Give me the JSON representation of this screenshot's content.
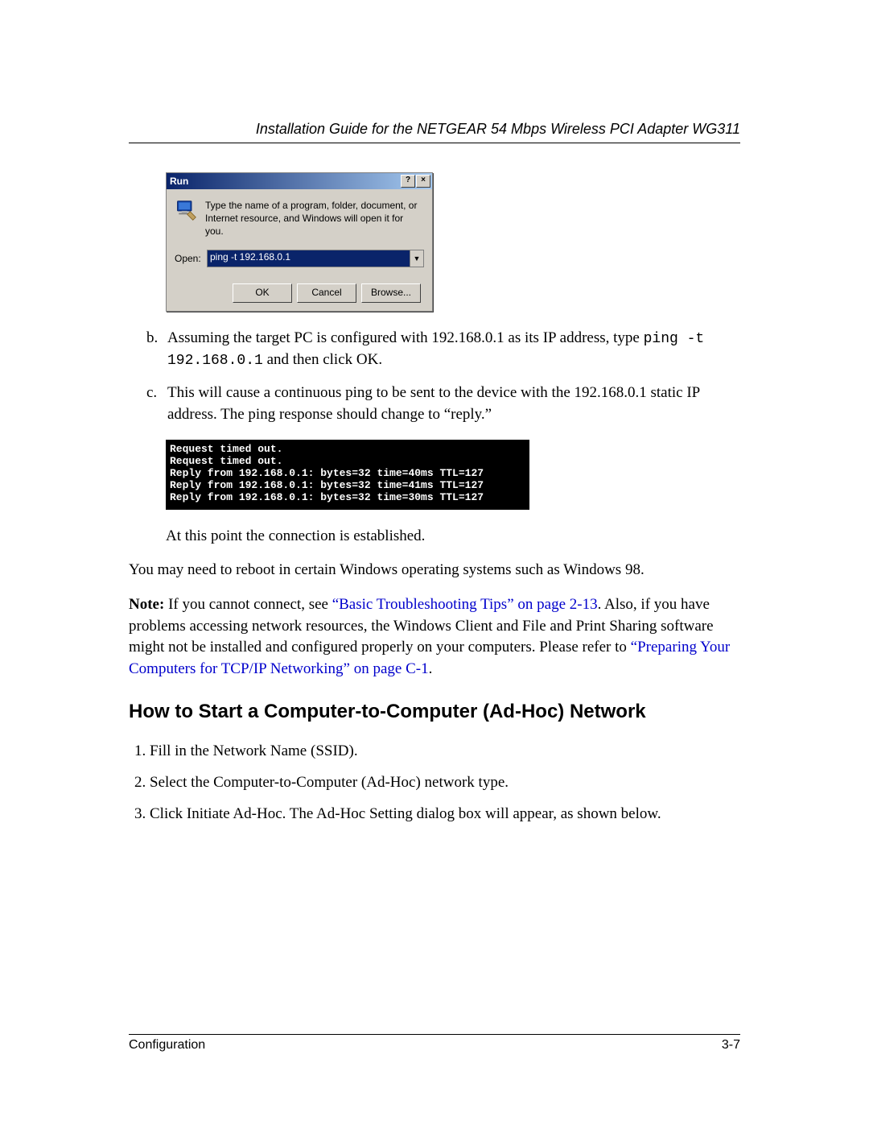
{
  "header": {
    "title": "Installation Guide for the NETGEAR 54 Mbps Wireless PCI Adapter WG311"
  },
  "run_dialog": {
    "title": "Run",
    "help_btn": "?",
    "close_btn": "×",
    "description": "Type the name of a program, folder, document, or Internet resource, and Windows will open it for you.",
    "open_label": "Open:",
    "open_value": "ping -t 192.168.0.1",
    "dropdown_glyph": "▼",
    "ok": "OK",
    "cancel": "Cancel",
    "browse": "Browse..."
  },
  "steps": {
    "b_marker": "b.",
    "b_text_1": "Assuming the target PC is configured with 192.168.0.1 as its IP address, type ",
    "b_code": "ping -t 192.168.0.1",
    "b_text_2": " and then click OK.",
    "c_marker": "c.",
    "c_text": "This will cause a continuous ping to be sent to the device with the 192.168.0.1 static IP address. The ping response should change to “reply.”"
  },
  "console_lines": "Request timed out.\nRequest timed out.\nReply from 192.168.0.1: bytes=32 time=40ms TTL=127\nReply from 192.168.0.1: bytes=32 time=41ms TTL=127\nReply from 192.168.0.1: bytes=32 time=30ms TTL=127",
  "para_established": "At this point the connection is established.",
  "para_reboot": "You may need to reboot in certain Windows operating systems such as Windows 98.",
  "note": {
    "label": "Note:",
    "pre": " If you cannot connect, see ",
    "link1": "“Basic Troubleshooting Tips” on page 2-13",
    "mid": ". Also, if you have problems accessing network resources, the Windows Client and File and Print Sharing software might not be installed and configured properly on your computers. Please refer to ",
    "link2": "“Preparing Your Computers for TCP/IP Networking” on page C-1",
    "post": "."
  },
  "section_heading": "How to Start a Computer-to-Computer (Ad-Hoc) Network",
  "numbered": [
    "Fill in the Network Name (SSID).",
    "Select the Computer-to-Computer (Ad-Hoc) network type.",
    "Click Initiate Ad-Hoc. The Ad-Hoc Setting dialog box will appear, as shown below."
  ],
  "footer": {
    "left": "Configuration",
    "right": "3-7"
  }
}
